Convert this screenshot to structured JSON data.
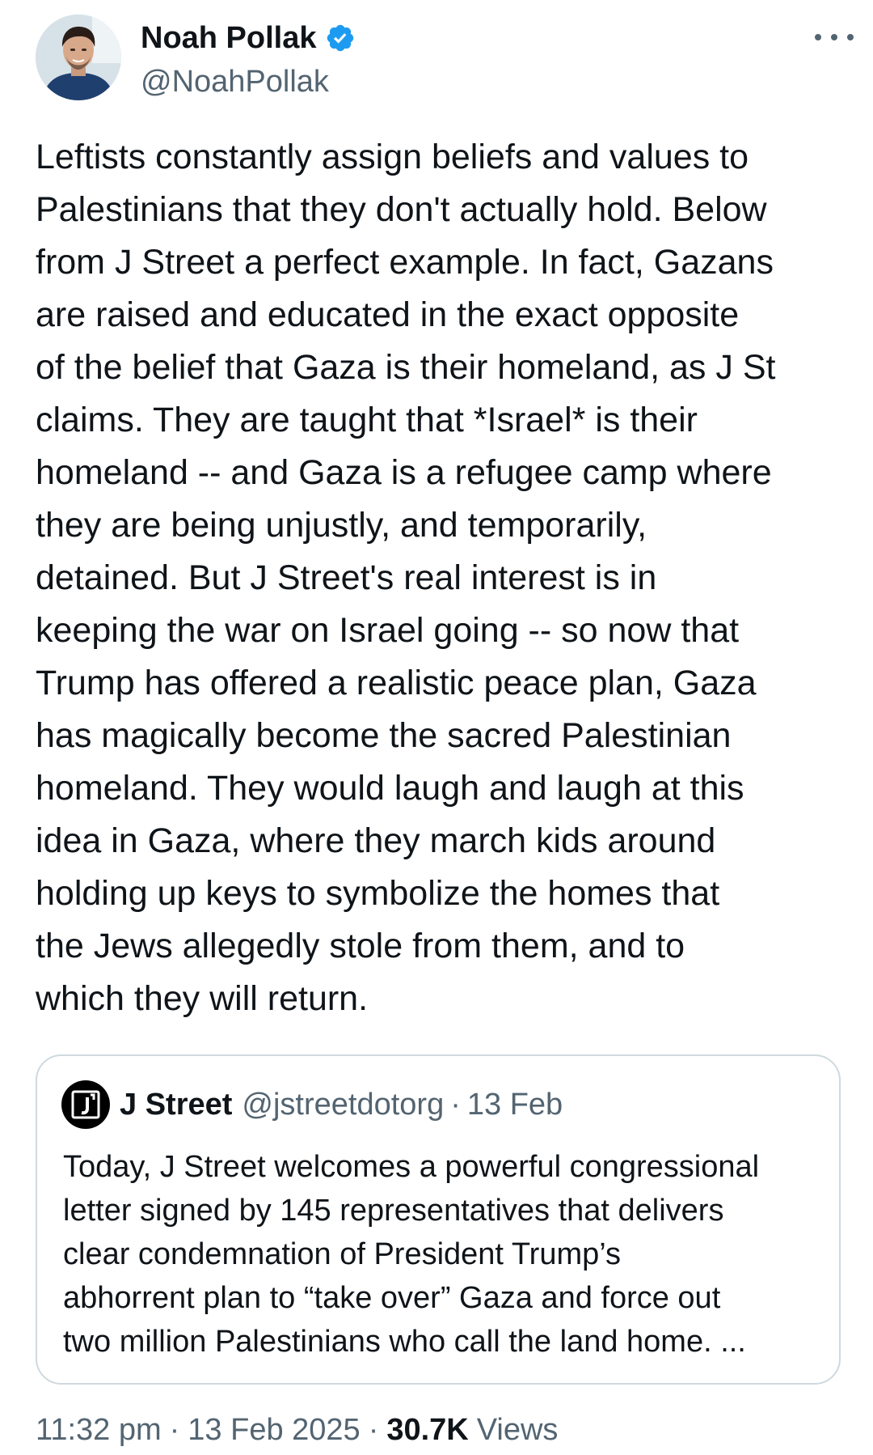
{
  "tweet": {
    "author": {
      "display_name": "Noah Pollak",
      "handle": "@NoahPollak",
      "verified": true,
      "verified_color": "#1d9bf0"
    },
    "more_icon": "more-horizontal-icon",
    "text": "Leftists constantly assign beliefs and values to\nPalestinians that they don't actually hold. Below\nfrom J Street a perfect example. In fact, Gazans\nare raised and educated in the exact opposite\nof the belief that Gaza is their homeland, as J St\nclaims. They are taught that *Israel* is their\nhomeland -- and Gaza is a refugee camp where\nthey are being unjustly, and temporarily,\ndetained. But J Street's real interest is in\nkeeping the war on Israel going -- so now that\nTrump has offered a realistic peace plan, Gaza\nhas magically become the sacred Palestinian\nhomeland. They would laugh and laugh at this\nidea in Gaza, where they march kids around\nholding up keys to symbolize the homes that\nthe Jews allegedly stole from them, and to\nwhich they will return.",
    "quoted": {
      "display_name": "J Street",
      "handle": "@jstreetdotorg",
      "separator": "·",
      "date": "13 Feb",
      "logo_icon": "j-street-logo-icon",
      "logo_letter": "J",
      "text": "Today, J Street welcomes a powerful congressional\nletter signed by 145 representatives that delivers\nclear condemnation of President Trump’s\nabhorrent plan to “take over” Gaza and force out\ntwo million Palestinians who call the land home. ..."
    },
    "meta": {
      "time": "11:32 pm",
      "separator": "·",
      "date": "13 Feb 2025",
      "views_count": "30.7K",
      "views_label": "Views"
    }
  }
}
